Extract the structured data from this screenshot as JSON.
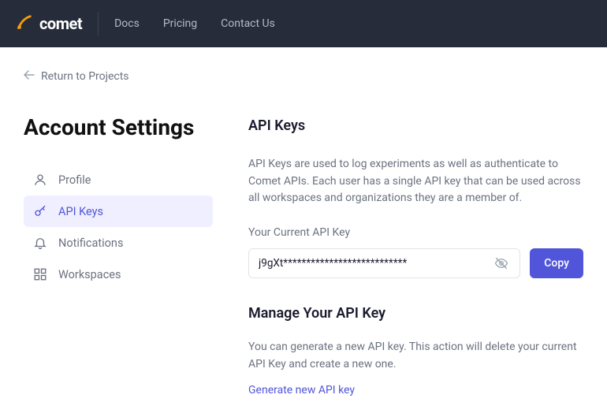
{
  "topnav": {
    "brand": "comet",
    "links": [
      "Docs",
      "Pricing",
      "Contact Us"
    ]
  },
  "return_link": "Return to Projects",
  "page_title": "Account Settings",
  "sidebar": {
    "items": [
      {
        "label": "Profile"
      },
      {
        "label": "API Keys"
      },
      {
        "label": "Notifications"
      },
      {
        "label": "Workspaces"
      }
    ]
  },
  "main": {
    "api_keys_title": "API Keys",
    "api_keys_desc": "API Keys are used to log experiments as well as authenticate to Comet APIs. Each user has a single API key that can be used across all workspaces and organizations they are a member of.",
    "current_key_label": "Your Current API Key",
    "current_key_value": "j9gXt***************************",
    "copy_label": "Copy",
    "manage_title": "Manage Your API Key",
    "manage_desc": "You can generate a new API key. This action will delete your current API Key and create a new one.",
    "generate_label": "Generate new API key"
  }
}
